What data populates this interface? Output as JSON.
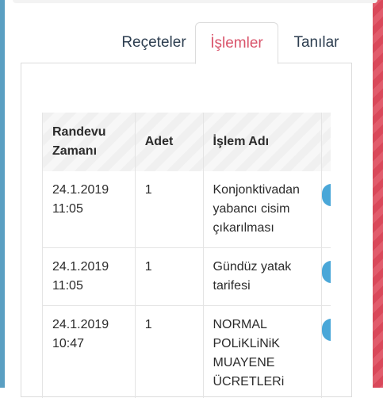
{
  "tabs": [
    {
      "label": "Reçeteler",
      "active": false
    },
    {
      "label": "İşlemler",
      "active": true
    },
    {
      "label": "Tanılar",
      "active": false
    }
  ],
  "table": {
    "columns": [
      "Randevu Zamanı",
      "Adet",
      "İşlem Adı"
    ],
    "rows": [
      {
        "date": "24.1.2019",
        "time": "11:05",
        "count": "1",
        "name": "Konjonktivadan yabancı cisim çıkarılması"
      },
      {
        "date": "24.1.2019",
        "time": "11:05",
        "count": "1",
        "name": "Gündüz yatak tarifesi"
      },
      {
        "date": "24.1.2019",
        "time": "10:47",
        "count": "1",
        "name": "NORMAL POLiKLiNiK MUAYENE ÜCRETLERi"
      }
    ]
  },
  "colors": {
    "active_tab": "#d9536a",
    "tab_text": "#2d3e50",
    "left_strip": "#5a9fc2",
    "right_strip": "#e15c6c",
    "row_action": "#4aa7d8"
  }
}
